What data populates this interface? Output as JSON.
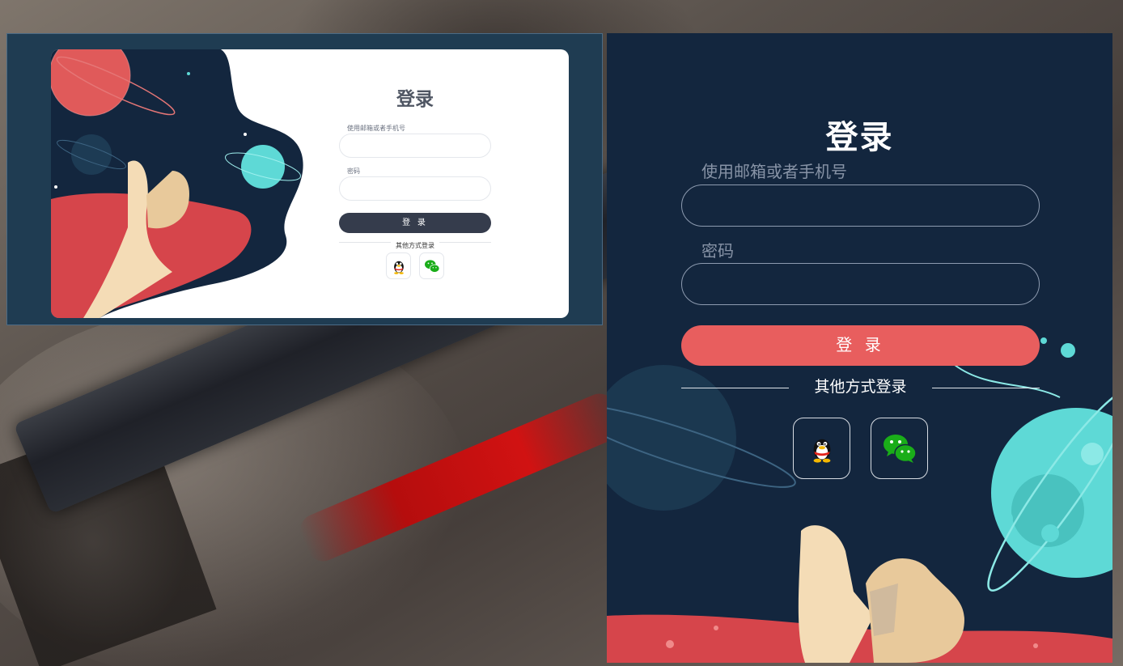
{
  "preview": {
    "title": "登录",
    "account_label": "使用邮箱或者手机号",
    "password_label": "密码",
    "login_button": "登 录",
    "other_login_text": "其他方式登录"
  },
  "form": {
    "title": "登录",
    "account_label": "使用邮箱或者手机号",
    "account_value": "",
    "password_label": "密码",
    "password_value": "",
    "login_button": "登 录",
    "other_login_text": "其他方式登录"
  },
  "social": [
    {
      "icon": "qq-icon"
    },
    {
      "icon": "wechat-icon"
    }
  ],
  "colors": {
    "panel_bg": "#13263e",
    "accent": "#e85e5e",
    "preview_button": "#353c4c",
    "planet_cyan": "#5ed9d6",
    "planet_red": "#e05a5a"
  }
}
